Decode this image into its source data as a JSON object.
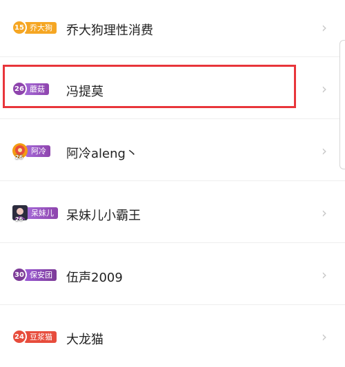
{
  "users": [
    {
      "level": "15",
      "badge": "乔大狗",
      "name": "乔大狗理性消费",
      "badge_color": "#f5a623",
      "level_color": "#f5a623"
    },
    {
      "level": "26",
      "badge": "蘑菇",
      "name": "冯提莫",
      "badge_color": "#9b59d6",
      "level_color": "#8e44ad"
    },
    {
      "level": "26",
      "badge": "阿冷",
      "name": "阿冷aleng丶",
      "badge_color": "#9b59d6",
      "level_color": "#e74c3c"
    },
    {
      "level": "26",
      "badge": "呆妹儿",
      "name": "呆妹儿小霸王",
      "badge_color": "#9b59d6",
      "level_color": "#6c3483"
    },
    {
      "level": "30",
      "badge": "保安团",
      "name": "伍声2009",
      "badge_color": "#8e44ad",
      "level_color": "#7d3c98"
    },
    {
      "level": "24",
      "badge": "豆浆猫",
      "name": "大龙猫",
      "badge_color": "#e74c3c",
      "level_color": "#e74c3c"
    }
  ],
  "icons": {
    "chevron": "chevron-right-icon"
  },
  "colors": {
    "highlight": "#e8353a",
    "divider": "#eeeeee",
    "chevron": "#c8c8c8"
  }
}
